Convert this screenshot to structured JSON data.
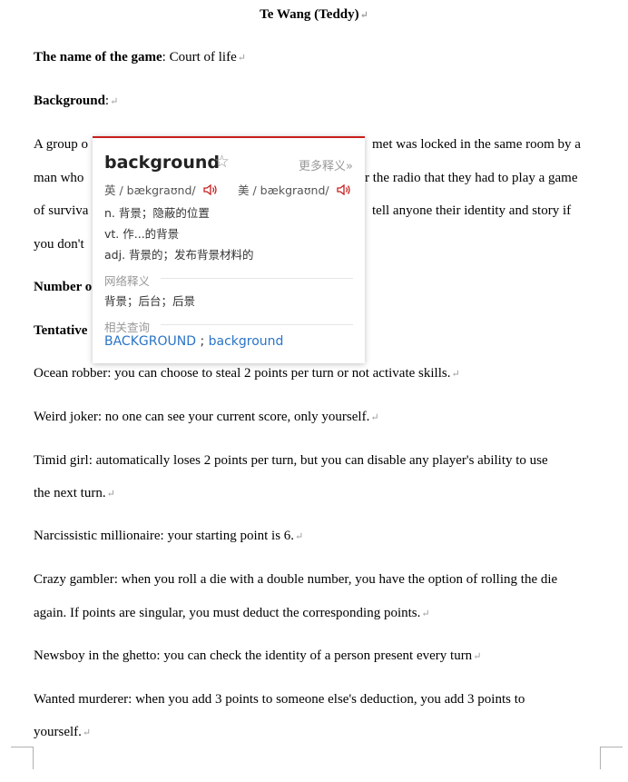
{
  "doc": {
    "title": "Te Wang (Teddy)",
    "game_name_label": "The name of the game",
    "game_name_value": ": Court of life",
    "background_label": "Background",
    "background_colon": ":",
    "para1_start": "A group o",
    "para1_end": "met was locked in the same room by a",
    "para2_start": "man who",
    "para2_end": "r the radio that they had to play a game",
    "para3_start": "of surviva",
    "para3_end": "tell anyone their identity and story if",
    "para4_start": "you don't",
    "number_label_partial": "Number o",
    "tentative_label_partial": "Tentative",
    "lines": [
      "Ocean robber: you can choose to steal 2 points per turn or not activate skills.",
      "Weird joker: no one can see your current score, only yourself.",
      "Timid girl: automatically loses 2 points per turn, but you can disable any player's ability to use",
      "the next turn.",
      "Narcissistic millionaire: your starting point is 6.",
      "Crazy gambler: when you roll a die with a double number, you have the option of rolling the die",
      "again. If points are singular, you must deduct the corresponding points.",
      "Newsboy in the ghetto: you can check the identity of a person present every turn",
      "Wanted murderer: when you add 3 points to someone else's deduction, you add 3 points to",
      "yourself."
    ],
    "para_mark": "↵"
  },
  "popup": {
    "word": "background",
    "star": "☆",
    "more": "更多释义»",
    "uk_phon": "英 / bækgraʊnd/",
    "us_phon": "美 / bækgraʊnd/",
    "defs": [
      "n. 背景；隐蔽的位置",
      "vt. 作...的背景",
      "adj. 背景的；发布背景材料的"
    ],
    "web_title": "网络释义",
    "web_defs": "背景；后台；后景",
    "related_title": "相关查询",
    "related_1": "BACKGROUND",
    "related_sep": " ; ",
    "related_2": "background",
    "colors": {
      "accent": "#c81e1e",
      "link": "#2a74c8"
    }
  }
}
